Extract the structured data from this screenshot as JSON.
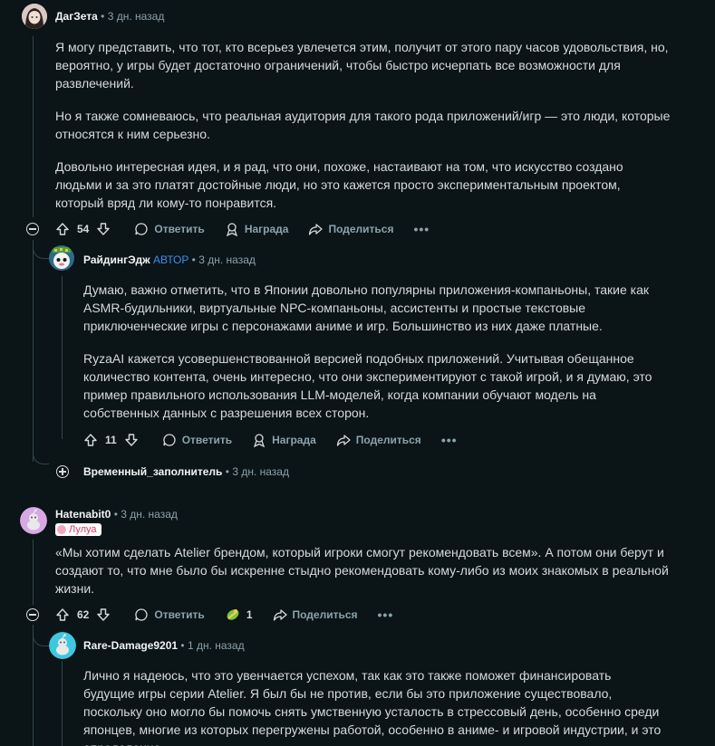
{
  "comments": [
    {
      "username": "ДагЗета",
      "time": "3 дн. назад",
      "paragraphs": [
        "Я могу представить, что тот, кто всерьез увлечется этим, получит от этого пару часов удовольствия, но, вероятно, у игры будет достаточно ограничений, чтобы быстро исчерпать все возможности для развлечений.",
        "Но я также сомневаюсь, что реальная аудитория для такого рода приложений/игр — это люди, которые относятся к ним серьезно.",
        "Довольно интересная идея, и я рад, что они, похоже, настаивают на том, что искусство создано людьми и за это платят достойные люди, но это кажется просто экспериментальным проектом, который вряд ли кому-то понравится."
      ],
      "votes": "54",
      "reply_label": "Ответить",
      "award_label": "Награда",
      "share_label": "Поделиться",
      "more_label": "•••"
    },
    {
      "username": "РайдингЭдж",
      "op_badge": "АВТОР",
      "time": "3 дн. назад",
      "paragraphs": [
        "Думаю, важно отметить, что в Японии довольно популярны приложения-компаньоны, такие как ASMR-будильники, виртуальные NPC-компаньоны, ассистенты и простые текстовые приключенческие игры с персонажами аниме и игр. Большинство из них даже платные.",
        "RyzaAI кажется усовершенствованной версией подобных приложений. Учитывая обещанное количество контента, очень интересно, что они экспериментируют с такой игрой, и я думаю, это пример правильного использования LLM-моделей, когда компании обучают модель на собственных данных с разрешения всех сторон."
      ],
      "votes": "11",
      "reply_label": "Ответить",
      "award_label": "Награда",
      "share_label": "Поделиться",
      "more_label": "•••"
    },
    {
      "username": "Временный_заполнитель",
      "time": "3 дн. назад"
    },
    {
      "username": "Hatenabit0",
      "time": "3 дн. назад",
      "flair": "Лулуа",
      "paragraphs": [
        "«Мы хотим сделать Atelier брендом, который игроки смогут рекомендовать всем». А потом они берут и создают то, что мне было бы искренне стыдно рекомендовать кому-либо из моих знакомых в реальной жизни."
      ],
      "votes": "62",
      "reply_label": "Ответить",
      "award_count": "1",
      "share_label": "Поделиться",
      "more_label": "•••"
    },
    {
      "username": "Rare-Damage9201",
      "time": "1 дн. назад",
      "paragraphs": [
        "Лично я надеюсь, что это увенчается успехом, так как это также поможет финансировать будущие игры серии Atelier. Я был бы не против, если бы это приложение существовало, поскольку оно могло бы помочь снять умственную усталость в стрессовый день, особенно среди японцев, многие из которых перегружены работой, особенно в аниме- и игровой индустрии, и это определенно"
      ]
    }
  ],
  "separator": "•"
}
